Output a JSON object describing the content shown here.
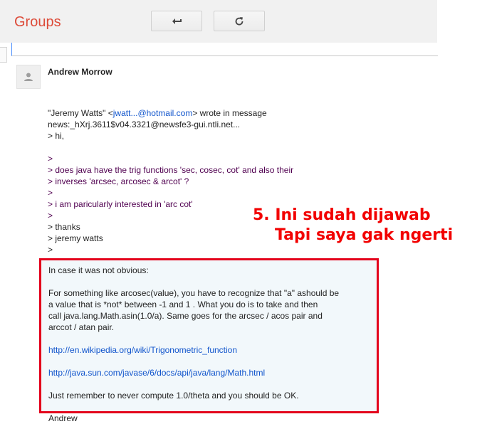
{
  "app": {
    "brand": "Groups"
  },
  "toolbar": {
    "back_icon": "back-arrow-icon",
    "refresh_icon": "refresh-icon"
  },
  "post": {
    "author": "Andrew Morrow",
    "lines": [
      {
        "parts": [
          {
            "text": "\"Jeremy Watts\" <",
            "kind": "text"
          },
          {
            "text": "jwatt...@hotmail.com",
            "kind": "link"
          },
          {
            "text": "> wrote in message",
            "kind": "text"
          }
        ]
      },
      {
        "parts": [
          {
            "text": "news:_hXrj.3611$v04.3321@newsfe3-gui.ntli.net...",
            "kind": "text"
          }
        ]
      },
      {
        "parts": [
          {
            "text": "> hi,",
            "kind": "text"
          }
        ]
      },
      {
        "parts": [
          {
            "text": "",
            "kind": "text"
          }
        ]
      },
      {
        "parts": [
          {
            "text": ">",
            "kind": "quote"
          }
        ]
      },
      {
        "parts": [
          {
            "text": "> does java have the trig functions 'sec, cosec, cot' and also their",
            "kind": "quote"
          }
        ]
      },
      {
        "parts": [
          {
            "text": "> inverses 'arcsec, arcosec & arcot' ?",
            "kind": "quote"
          }
        ]
      },
      {
        "parts": [
          {
            "text": ">",
            "kind": "quote"
          }
        ]
      },
      {
        "parts": [
          {
            "text": "> i am paricularly interested in 'arc cot'",
            "kind": "quote"
          }
        ]
      },
      {
        "parts": [
          {
            "text": ">",
            "kind": "quote"
          }
        ]
      },
      {
        "parts": [
          {
            "text": "> thanks",
            "kind": "text"
          }
        ]
      },
      {
        "parts": [
          {
            "text": "> jeremy watts",
            "kind": "text"
          }
        ]
      },
      {
        "parts": [
          {
            "text": ">",
            "kind": "text"
          }
        ]
      }
    ],
    "answer": [
      {
        "text": "In case it was not obvious:",
        "kind": "text"
      },
      {
        "text": "",
        "kind": "text"
      },
      {
        "text": "For something like arcosec(value), you have to recognize that \"a\" ashould be",
        "kind": "text"
      },
      {
        "text": "a value that is *not* between -1 and 1 . What you do is to take and then",
        "kind": "text"
      },
      {
        "text": "call java.lang.Math.asin(1.0/a).  Same goes for the arcsec / acos pair and",
        "kind": "text"
      },
      {
        "text": "arccot / atan pair.",
        "kind": "text"
      },
      {
        "text": "",
        "kind": "text"
      },
      {
        "text": "http://en.wikipedia.org/wiki/Trigonometric_function",
        "kind": "link"
      },
      {
        "text": "",
        "kind": "text"
      },
      {
        "text": "http://java.sun.com/javase/6/docs/api/java/lang/Math.html",
        "kind": "link"
      },
      {
        "text": "",
        "kind": "text"
      },
      {
        "text": "Just remember to never compute 1.0/theta and you should be OK.",
        "kind": "text"
      },
      {
        "text": "",
        "kind": "text"
      },
      {
        "text": "Andrew",
        "kind": "text"
      }
    ]
  },
  "annotation": {
    "line1": "5. Ini sudah dijawab",
    "line2": "Tapi saya gak ngerti",
    "color": "#f20000"
  },
  "colors": {
    "brand": "#dd4b39",
    "link": "#1155cc",
    "quote": "#500050",
    "highlight_border": "#e3001b"
  }
}
